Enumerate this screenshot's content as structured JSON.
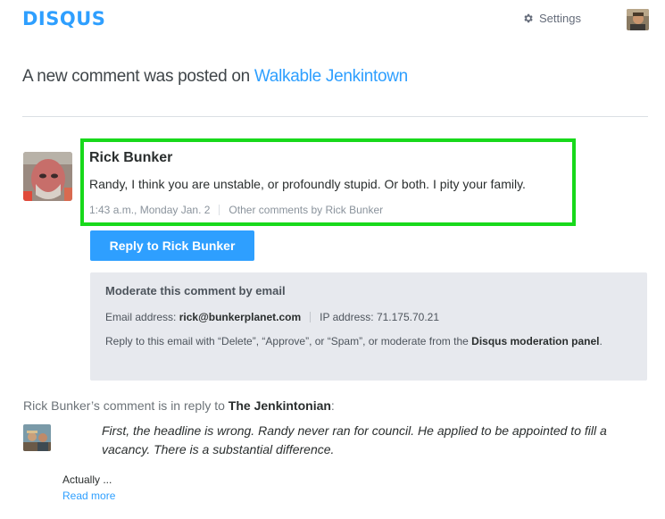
{
  "header": {
    "logo": "DISQUS",
    "settings_label": "Settings",
    "settings_icon": "gear-icon",
    "user_avatar": "user-avatar"
  },
  "notification": {
    "headline_prefix": "A new comment was posted on",
    "site_link": "Walkable Jenkintown"
  },
  "comment": {
    "author": "Rick Bunker",
    "text": "Randy, I think you are unstable, or profoundly stupid. Or both. I pity your family.",
    "timestamp": "1:43 a.m., Monday Jan. 2",
    "other_comments_link": "Other comments by Rick Bunker",
    "highlight_color": "#18d91b"
  },
  "reply_button": "Reply to Rick Bunker",
  "moderation": {
    "title": "Moderate this comment by email",
    "email_label": "Email address:",
    "email_value": "rick@bunkerplanet.com",
    "ip_label": "IP address:",
    "ip_value": "71.175.70.21",
    "instructions_prefix": "Reply to this email with “Delete”, “Approve”, or “Spam”, or moderate from the",
    "panel_link": "Disqus moderation panel",
    "instructions_suffix": "."
  },
  "parent": {
    "reply_prefix": "Rick Bunker’s comment is in reply to",
    "parent_author": "The Jenkintonian",
    "reply_suffix": ":",
    "quote": "First, the headline is wrong. Randy never ran for council. He applied to be appointed to fill a vacancy. There is a substantial difference.",
    "excerpt": "Actually ...",
    "read_more": "Read more"
  },
  "colors": {
    "brand": "#2e9fff",
    "moderation_bg": "#e7e9ee"
  }
}
